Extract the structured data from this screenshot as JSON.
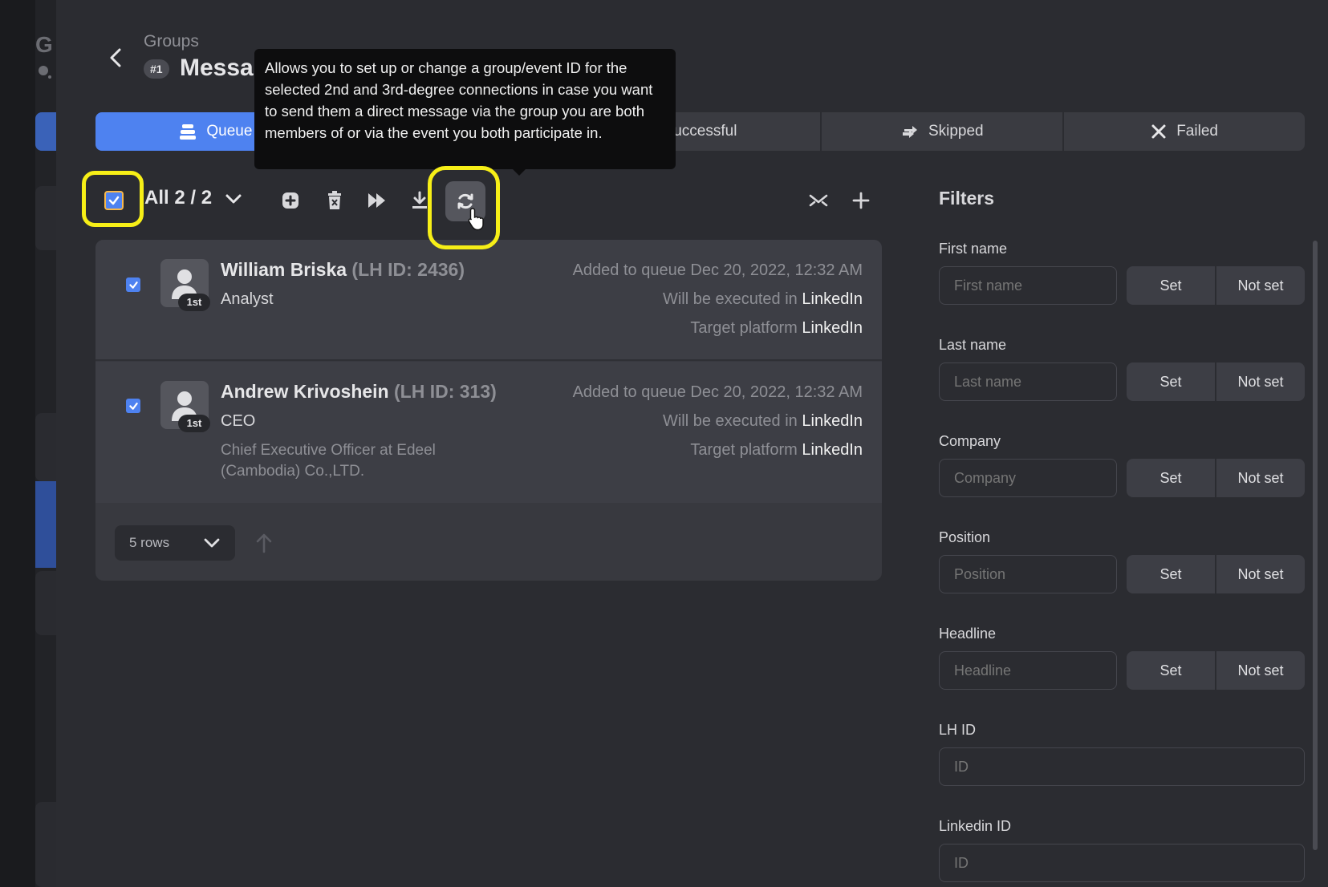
{
  "sidebar": {
    "letter": "G"
  },
  "header": {
    "breadcrumb": "Groups",
    "badge": "#1",
    "title": "Messag"
  },
  "tabs": [
    {
      "label": "Queue",
      "icon": "stack-icon",
      "active": true
    },
    {
      "label": "",
      "icon": "",
      "active": false
    },
    {
      "label": "Successful",
      "icon": "",
      "active": false
    },
    {
      "label": "Skipped",
      "icon": "skip-icon",
      "active": false
    },
    {
      "label": "Failed",
      "icon": "x-icon",
      "active": false
    }
  ],
  "tooltip": {
    "text": "Allows you to set up or change a group/event ID for the selected 2nd and 3rd-degree connections in case you want to send them a direct message via the group you are both members of or via the event you both participate in."
  },
  "toolbar": {
    "selection": "All 2 / 2"
  },
  "queue": {
    "rows": [
      {
        "name": "William Briska",
        "lhid": "(LH ID: 2436)",
        "degree": "1st",
        "role": "Analyst",
        "desc": "",
        "added_label": "Added to queue",
        "added": "Dec 20, 2022, 12:32 AM",
        "executed_label": "Will be executed in",
        "executed": "LinkedIn",
        "target_label": "Target platform",
        "target": "LinkedIn"
      },
      {
        "name": "Andrew Krivoshein",
        "lhid": "(LH ID: 313)",
        "degree": "1st",
        "role": "CEO",
        "desc": "Chief Executive Officer at Edeel (Cambodia) Co.,LTD.",
        "added_label": "Added to queue",
        "added": "Dec 20, 2022, 12:32 AM",
        "executed_label": "Will be executed in",
        "executed": "LinkedIn",
        "target_label": "Target platform",
        "target": "LinkedIn"
      }
    ],
    "rows_per_page": "5 rows"
  },
  "filters": {
    "title": "Filters",
    "set_label": "Set",
    "notset_label": "Not set",
    "fields": [
      {
        "label": "First name",
        "placeholder": "First name"
      },
      {
        "label": "Last name",
        "placeholder": "Last name"
      },
      {
        "label": "Company",
        "placeholder": "Company"
      },
      {
        "label": "Position",
        "placeholder": "Position"
      },
      {
        "label": "Headline",
        "placeholder": "Headline"
      }
    ],
    "lhid": {
      "label": "LH ID",
      "placeholder": "ID"
    },
    "linkedin_id": {
      "label": "Linkedin ID",
      "placeholder": "ID"
    }
  },
  "colors": {
    "accent": "#4e82f0",
    "highlight": "#f7ef17",
    "background": "#2b2c31"
  }
}
